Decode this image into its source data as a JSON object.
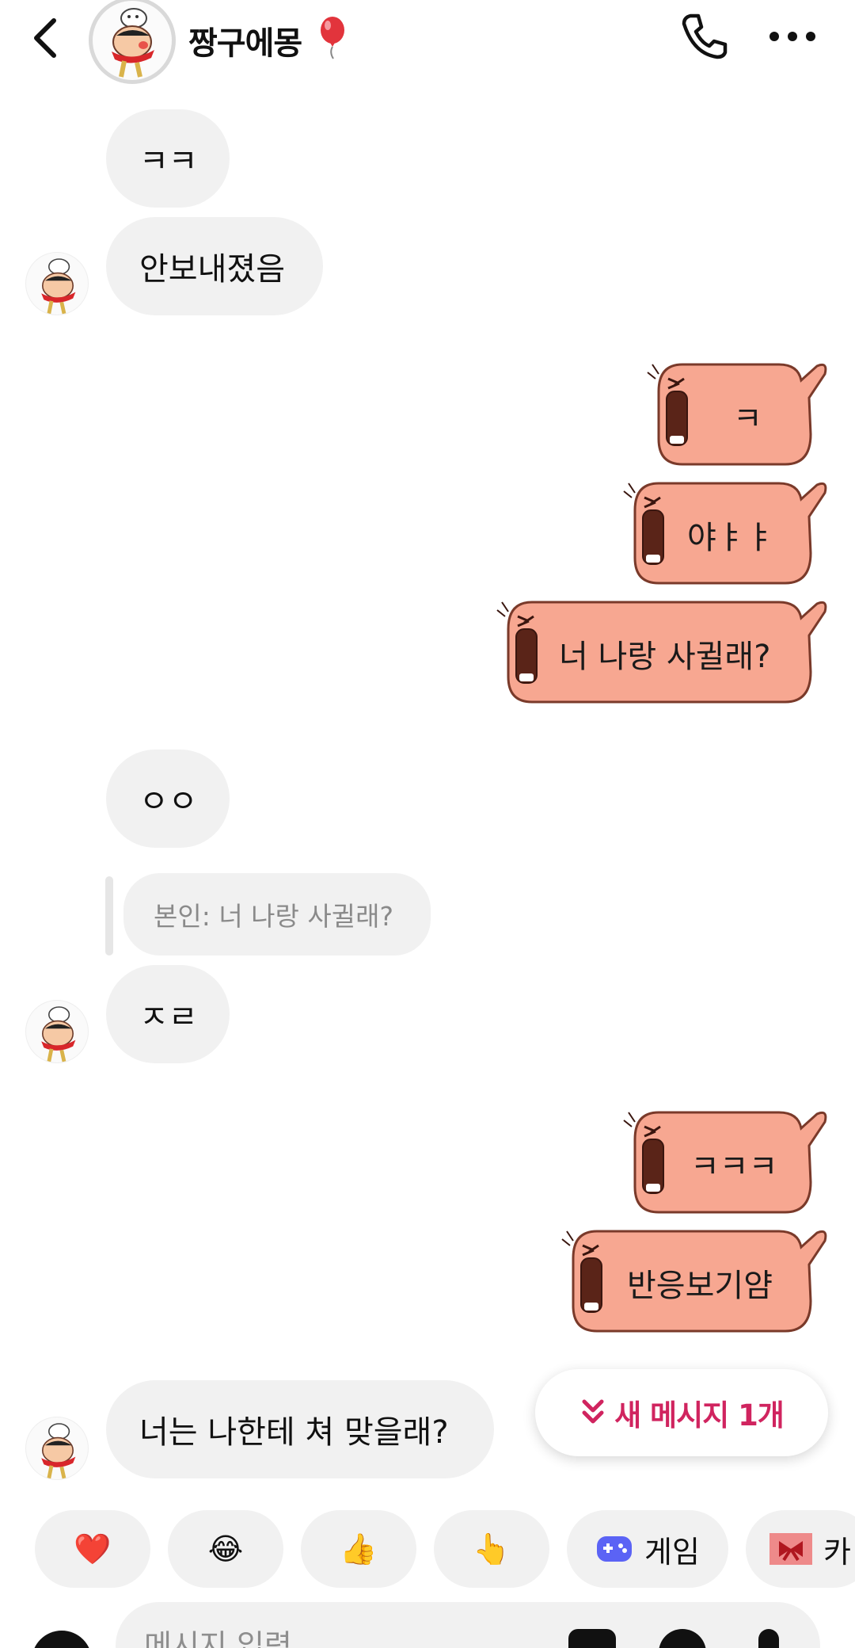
{
  "header": {
    "title": "짱구에몽",
    "back_icon": "chevron-left-icon",
    "call_icon": "phone-icon",
    "more_icon": "more-horizontal-icon"
  },
  "messages": [
    {
      "side": "in",
      "text": "ㅋㅋ"
    },
    {
      "side": "in",
      "text": "안보내졌음"
    },
    {
      "side": "out",
      "text": "ㅋ",
      "style": "fish-sticker"
    },
    {
      "side": "out",
      "text": "야ㅑㅑ",
      "style": "fish-sticker"
    },
    {
      "side": "out",
      "text": "너 나랑 사귈래?",
      "style": "fish-sticker"
    },
    {
      "side": "in",
      "text": "ㅇㅇ"
    },
    {
      "side": "in",
      "text": "ㅈㄹ",
      "reply_to": "본인: 너 나랑 사귈래?"
    },
    {
      "side": "out",
      "text": "ㅋㅋㅋ",
      "style": "fish-sticker"
    },
    {
      "side": "out",
      "text": "반응보기얌",
      "style": "fish-sticker"
    },
    {
      "side": "in",
      "text": "너는 나한테 쳐 맞을래?"
    }
  ],
  "new_message_pill": {
    "label": "새 메시지 1개",
    "icon": "double-chevron-down-icon"
  },
  "quick_replies": [
    {
      "label": "❤️",
      "icon": "heart-emoji"
    },
    {
      "label": "😂",
      "icon": "laughing-emoji"
    },
    {
      "label": "👍",
      "icon": "thumbs-up-emoji"
    },
    {
      "label": "👆",
      "icon": "pointing-emoji"
    },
    {
      "label": "게임",
      "icon": "gamepad-icon"
    },
    {
      "label": "카",
      "icon": "gift-ribbon-icon"
    }
  ],
  "composer": {
    "placeholder": "메시지 입력...",
    "icons": [
      "camera-icon",
      "image-icon",
      "sticker-icon",
      "mic-icon"
    ]
  },
  "colors": {
    "incoming_bubble": "#f1f1f1",
    "sticker_fill": "#f7a791",
    "sticker_outline": "#7a3a2a",
    "accent": "#d0245f",
    "gamepad": "#5b63f5"
  }
}
